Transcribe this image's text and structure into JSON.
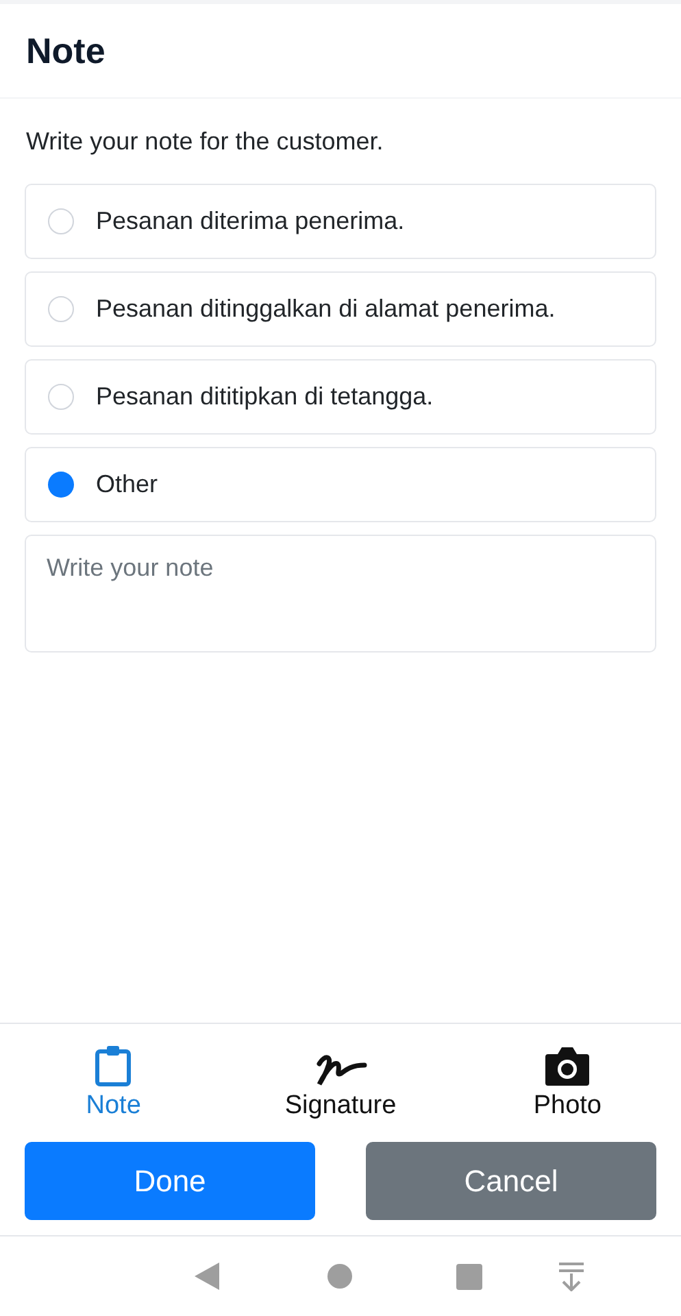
{
  "header": {
    "title": "Note"
  },
  "instruction": "Write your note for the customer.",
  "options": [
    {
      "label": "Pesanan diterima penerima.",
      "selected": false
    },
    {
      "label": "Pesanan ditinggalkan di alamat penerima.",
      "selected": false
    },
    {
      "label": "Pesanan dititipkan di tetangga.",
      "selected": false
    },
    {
      "label": "Other",
      "selected": true
    }
  ],
  "note_field": {
    "placeholder": "Write your note"
  },
  "tabs": [
    {
      "kind": "note",
      "label": "Note",
      "selected": true
    },
    {
      "kind": "signature",
      "label": "Signature",
      "selected": false
    },
    {
      "kind": "photo",
      "label": "Photo",
      "selected": false
    }
  ],
  "buttons": [
    {
      "kind": "primary",
      "label": "Done"
    },
    {
      "kind": "secondary",
      "label": "Cancel"
    }
  ]
}
